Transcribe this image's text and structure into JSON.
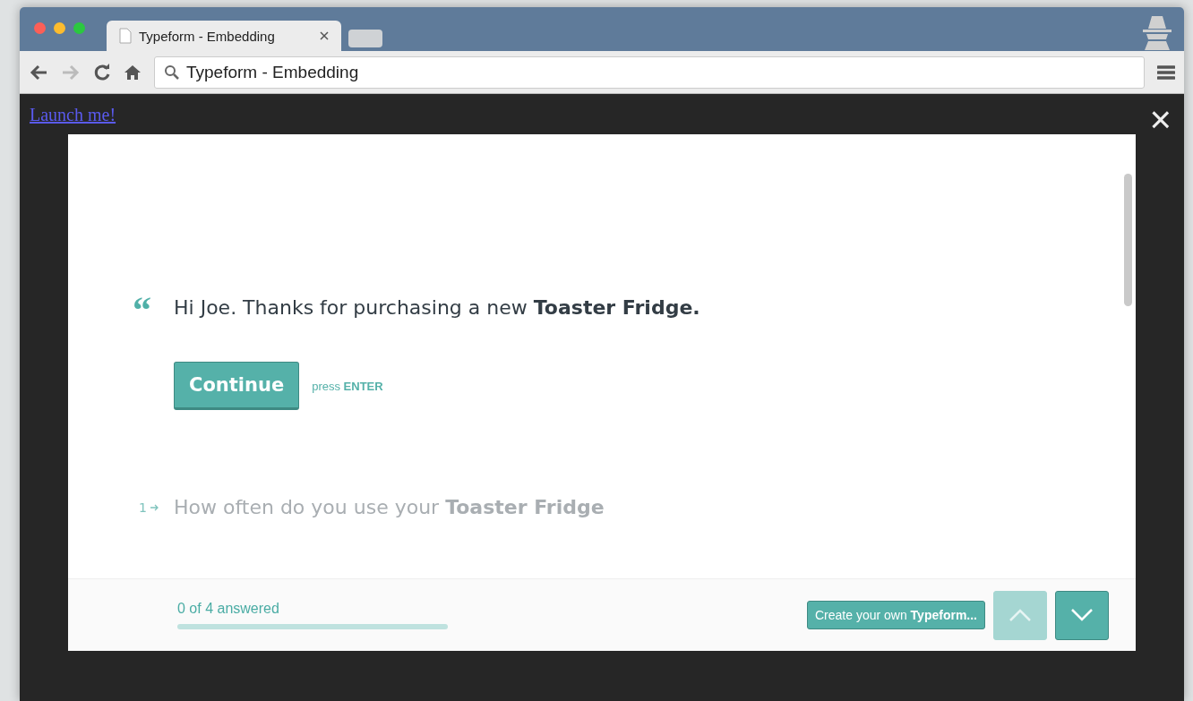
{
  "browser": {
    "tabs": [
      {
        "title": "Typeform - Embedding",
        "selected": true
      }
    ],
    "address": "Typeform - Embedding"
  },
  "page": {
    "link": "Launch me!",
    "close": "×"
  },
  "form": {
    "questions": [
      {
        "kind": "statement",
        "mark": "“",
        "text": "Hi Joe. Thanks for purchasing a new **Toaster Fridge.**",
        "button": "Continue",
        "hint": "press **ENTER**"
      },
      {
        "kind": "question",
        "number": "1",
        "text": "How often do you use your **Toaster Fridge**"
      }
    ],
    "progress": {
      "label": "0 of 4 answered",
      "level": 0
    },
    "create_button": "Create your own **Typeform...**",
    "nav": [
      {
        "kind": "up",
        "disabled": true
      },
      {
        "kind": "down",
        "disabled": false
      }
    ]
  }
}
